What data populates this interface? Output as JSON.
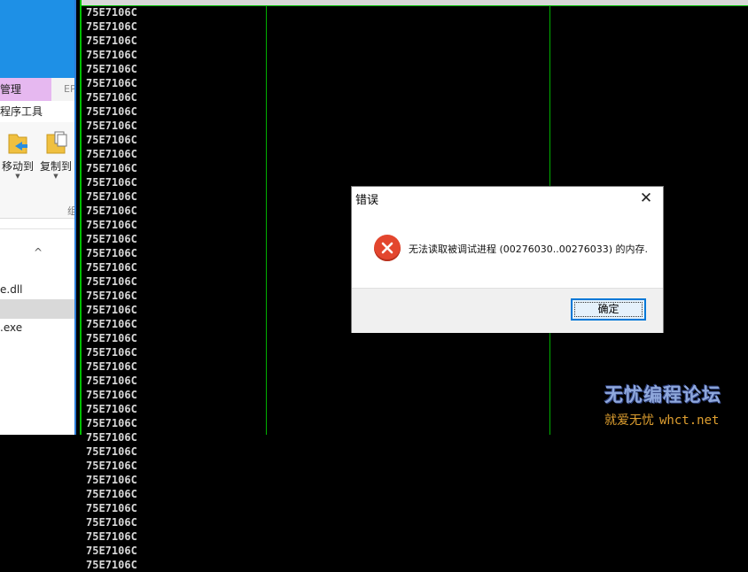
{
  "explorer": {
    "tab_manage": "管理",
    "tab_ep": "EP",
    "tab_tools": "程序工具",
    "ribbon": {
      "move_to": "移动到",
      "copy_to": "复制到",
      "group_label": "组"
    },
    "files": [
      {
        "name": "e.dll",
        "selected": false
      },
      {
        "name": "",
        "selected": true
      },
      {
        "name": ".exe",
        "selected": false
      }
    ]
  },
  "dump": {
    "addresses": [
      "75E7106C",
      "75E7106C",
      "75E7106C",
      "75E7106C",
      "75E7106C",
      "75E7106C",
      "75E7106C",
      "75E7106C",
      "75E7106C",
      "75E7106C",
      "75E7106C",
      "75E7106C",
      "75E7106C",
      "75E7106C",
      "75E7106C",
      "75E7106C",
      "75E7106C",
      "75E7106C",
      "75E7106C",
      "75E7106C",
      "75E7106C",
      "75E7106C",
      "75E7106C",
      "75E7106C",
      "75E7106C",
      "75E7106C",
      "75E7106C",
      "75E7106C",
      "75E7106C",
      "75E7106C",
      "75E7106C",
      "75E7106C",
      "75E7106C",
      "75E7106C",
      "75E7106C",
      "75E7106C",
      "75E7106C",
      "75E7106C",
      "75E7106C",
      "75E7106C"
    ],
    "colors": {
      "text": "#d8d8d8",
      "grid": "#00b000",
      "background": "#000000"
    }
  },
  "dialog": {
    "title": "错误",
    "close_glyph": "✕",
    "icon": "error-icon",
    "message": "无法读取被调试进程 (00276030..00276033) 的内存.",
    "ok_label": "确定"
  },
  "watermark": {
    "line1": "无忧编程论坛",
    "line2_cn": "就爱无忧",
    "line2_en": "whct.net"
  }
}
